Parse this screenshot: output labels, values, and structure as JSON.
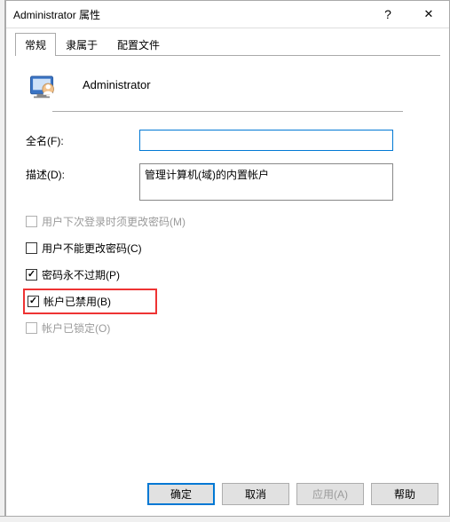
{
  "titlebar": {
    "title": "Administrator 属性",
    "help": "?",
    "close": "✕"
  },
  "tabs": {
    "general": "常规",
    "memberof": "隶属于",
    "profile": "配置文件"
  },
  "user": {
    "name": "Administrator"
  },
  "labels": {
    "fullname": "全名(F):",
    "description": "描述(D):"
  },
  "fields": {
    "fullname_value": "",
    "description_value": "管理计算机(域)的内置帐户"
  },
  "checks": {
    "must_change": "用户下次登录时须更改密码(M)",
    "cannot_change": "用户不能更改密码(C)",
    "never_expires": "密码永不过期(P)",
    "disabled": "帐户已禁用(B)",
    "locked": "帐户已锁定(O)"
  },
  "buttons": {
    "ok": "确定",
    "cancel": "取消",
    "apply": "应用(A)",
    "help": "帮助"
  }
}
